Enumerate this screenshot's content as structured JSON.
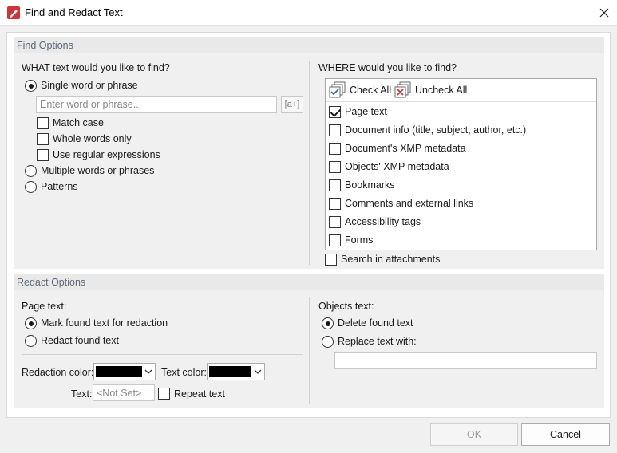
{
  "window": {
    "title": "Find and Redact Text",
    "accent_color": "#d13438"
  },
  "find_options": {
    "header": "Find Options",
    "what": {
      "label": "WHAT text would you like to find?",
      "single_word_label": "Single word or phrase",
      "search_placeholder": "Enter word or phrase...",
      "expand_button": "[a+]",
      "match_case": "Match case",
      "whole_words": "Whole words only",
      "regex": "Use regular expressions",
      "multiple_words": "Multiple words or phrases",
      "patterns": "Patterns",
      "selected": "single"
    },
    "where": {
      "label": "WHERE would you like to find?",
      "check_all": "Check All",
      "uncheck_all": "Uncheck All",
      "items": [
        {
          "label": "Page text",
          "checked": true
        },
        {
          "label": "Document info (title, subject, author, etc.)",
          "checked": false
        },
        {
          "label": "Document's XMP metadata",
          "checked": false
        },
        {
          "label": "Objects' XMP metadata",
          "checked": false
        },
        {
          "label": "Bookmarks",
          "checked": false
        },
        {
          "label": "Comments and external links",
          "checked": false
        },
        {
          "label": "Accessibility tags",
          "checked": false
        },
        {
          "label": "Forms",
          "checked": false
        }
      ],
      "search_attachments": "Search in attachments"
    }
  },
  "redact_options": {
    "header": "Redact Options",
    "page_text": {
      "label": "Page text:",
      "mark_found": "Mark found text for redaction",
      "redact_found": "Redact found text",
      "selected": "mark"
    },
    "redaction_color_label": "Redaction color:",
    "redaction_color": "#000000",
    "text_color_label": "Text color:",
    "text_color": "#000000",
    "text_label": "Text:",
    "text_placeholder": "<Not Set>",
    "repeat_text": "Repeat text",
    "objects_text": {
      "label": "Objects text:",
      "delete_found": "Delete found text",
      "replace_with": "Replace text with:",
      "replace_value": "",
      "selected": "delete"
    }
  },
  "footer": {
    "ok": "OK",
    "cancel": "Cancel"
  }
}
